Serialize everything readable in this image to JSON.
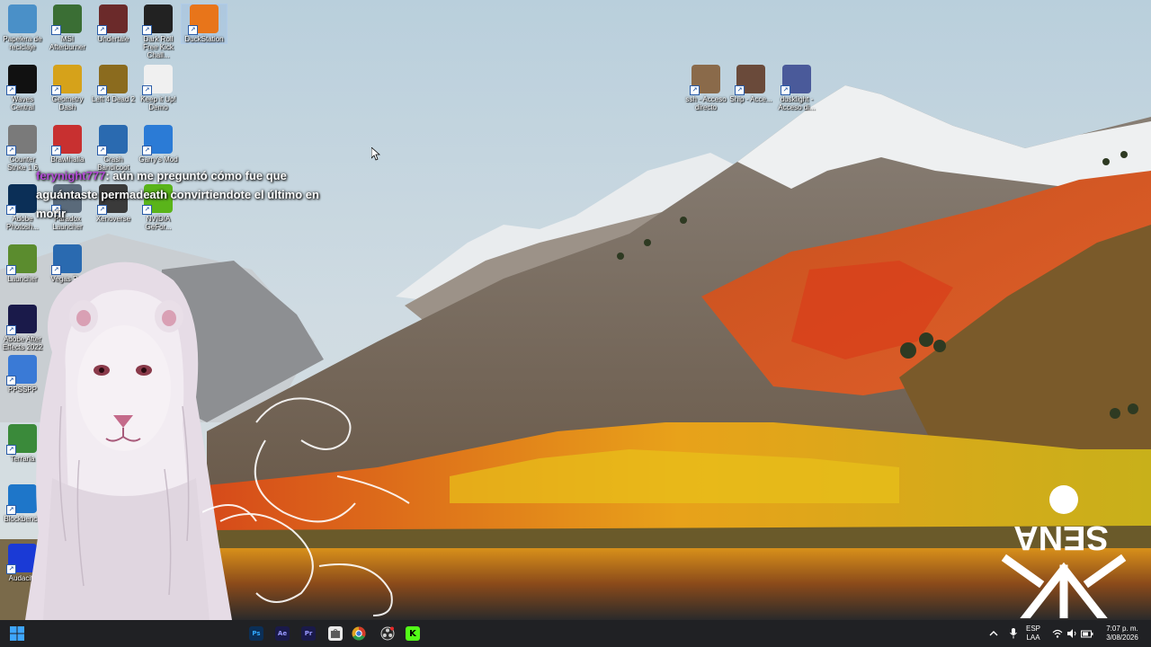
{
  "desktop_icons": [
    {
      "id": "recycle",
      "label": "Papelera de reciclaje",
      "icon": "recycle-bin-icon",
      "color": "#4a90c8"
    },
    {
      "id": "msi",
      "label": "MSI Afterburner",
      "icon": "afterburner-icon",
      "color": "#3a6e34"
    },
    {
      "id": "undertale",
      "label": "Undertale",
      "icon": "undertale-icon",
      "color": "#6b2a2a"
    },
    {
      "id": "darkroll",
      "label": "Dark Roll Free Kick Chall...",
      "icon": "soccer-ball-icon",
      "color": "#222222"
    },
    {
      "id": "duckstation",
      "label": "DuckStation",
      "icon": "duckstation-icon",
      "color": "#e8751a"
    },
    {
      "id": "waves",
      "label": "Waves Central",
      "icon": "waves-icon",
      "color": "#111111"
    },
    {
      "id": "geometry",
      "label": "Geometry Dash",
      "icon": "geometry-dash-icon",
      "color": "#d6a21a"
    },
    {
      "id": "l4d2",
      "label": "Left 4 Dead 2",
      "icon": "left4dead-icon",
      "color": "#8b6b1e"
    },
    {
      "id": "keepitup",
      "label": "Keep it Up! Demo",
      "icon": "keep-it-up-icon",
      "color": "#f0f0f0"
    },
    {
      "id": "cs",
      "label": "Counter Strike 1.6",
      "icon": "counter-strike-icon",
      "color": "#7a7a7a"
    },
    {
      "id": "brawl",
      "label": "Brawlhalla",
      "icon": "brawl-icon",
      "color": "#c83030"
    },
    {
      "id": "crash",
      "label": "Crash Bandicoot",
      "icon": "crash-icon",
      "color": "#2a6ab0"
    },
    {
      "id": "gmod",
      "label": "Garry's Mod",
      "icon": "gmod-icon",
      "color": "#2b7bd6"
    },
    {
      "id": "ps",
      "label": "Adobe Photosh...",
      "icon": "photoshop-icon",
      "color": "#0b2f57"
    },
    {
      "id": "pdx",
      "label": "Paradox Launcher",
      "icon": "paradox-icon",
      "color": "#5a6a7a"
    },
    {
      "id": "xenoverse",
      "label": "Xenoverse",
      "icon": "xenoverse-icon",
      "color": "#3a3a3a"
    },
    {
      "id": "nvidia",
      "label": "NVIDIA GeFor...",
      "icon": "nvidia-icon",
      "color": "#5ab41a"
    },
    {
      "id": "mc",
      "label": "Launcher",
      "icon": "minecraft-icon",
      "color": "#5b8c2e"
    },
    {
      "id": "vegas",
      "label": "Vegas Pro",
      "icon": "vegas-icon",
      "color": "#2a6ab0"
    },
    {
      "id": "ae",
      "label": "Adobe After Effects 2022",
      "icon": "after-effects-icon",
      "color": "#1a1a4a"
    },
    {
      "id": "ppsspp",
      "label": "PPSSPP",
      "icon": "ppsspp-icon",
      "color": "#3a7ad6"
    },
    {
      "id": "terraria",
      "label": "Terraria",
      "icon": "terraria-icon",
      "color": "#3a8a3a"
    },
    {
      "id": "blockbench",
      "label": "Blockbench",
      "icon": "blockbench-icon",
      "color": "#1e76c9"
    },
    {
      "id": "audacity",
      "label": "Audacity",
      "icon": "audacity-icon",
      "color": "#1a3ad6"
    },
    {
      "id": "ssh",
      "label": "ssh - Acceso directo",
      "icon": "shortcut-icon",
      "color": "#8a6a4a"
    },
    {
      "id": "ship",
      "label": "Ship - Acce...",
      "icon": "shortcut-icon",
      "color": "#6a4a3a"
    },
    {
      "id": "dusklight",
      "label": "dusklight - Acceso di...",
      "icon": "dusklight-icon",
      "color": "#4a5a9a"
    }
  ],
  "chat": {
    "username": "ferynight777",
    "separator": ":",
    "message": "aún me preguntó cómo fue que aguántaste permadeath convirtiendote el último en morir"
  },
  "taskbar": {
    "apps": [
      {
        "label": "Ps",
        "icon": "photoshop-icon",
        "color": "#0b2f57",
        "text_color": "#31a8ff"
      },
      {
        "label": "Ae",
        "icon": "after-effects-icon",
        "color": "#1a1a4a",
        "text_color": "#9999ff"
      },
      {
        "label": "Pr",
        "icon": "premiere-icon",
        "color": "#1a1a4a",
        "text_color": "#9999ff"
      }
    ],
    "tray": {
      "language_top": "ESP",
      "language_bottom": "LAA",
      "time": "7:07 p. m.",
      "date": "3/08/2026"
    }
  },
  "logo_text": "SENA"
}
